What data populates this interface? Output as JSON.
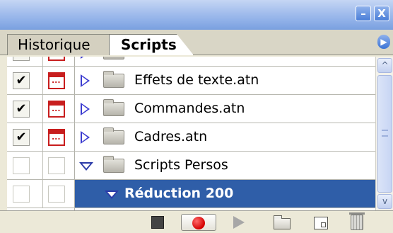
{
  "titlebar": {
    "minimize_glyph": "–",
    "close_glyph": "X"
  },
  "tabs": [
    {
      "label": "Historique",
      "active": false
    },
    {
      "label": "Scripts",
      "active": true
    }
  ],
  "tab_menu_icon": "flyout-menu-icon",
  "rows": [
    {
      "label": "Effets de texte.atn",
      "checked": true,
      "dialog": true,
      "expanded": false,
      "selected": false,
      "icon": "folder-icon"
    },
    {
      "label": "Commandes.atn",
      "checked": true,
      "dialog": true,
      "expanded": false,
      "selected": false,
      "icon": "folder-icon"
    },
    {
      "label": "Cadres.atn",
      "checked": true,
      "dialog": true,
      "expanded": false,
      "selected": false,
      "icon": "folder-icon"
    },
    {
      "label": "Scripts Persos",
      "checked": false,
      "dialog": false,
      "expanded": true,
      "selected": false,
      "icon": "folder-icon"
    },
    {
      "label": "Réduction 200",
      "checked": false,
      "dialog": false,
      "expanded": true,
      "selected": true,
      "icon": "none"
    }
  ],
  "check_glyph": "✔",
  "scrollbar": {
    "up_glyph": "^",
    "down_glyph": "v"
  },
  "toolbar": [
    {
      "name": "stop-icon"
    },
    {
      "name": "record-icon"
    },
    {
      "name": "play-icon"
    },
    {
      "name": "new-set-icon"
    },
    {
      "name": "new-action-icon"
    },
    {
      "name": "trash-icon"
    }
  ],
  "colors": {
    "selection": "#2f5ea8",
    "title_gradient_bottom": "#7aa0df",
    "dialog_red": "#c81e1e",
    "triangle_blue": "#3b3bd0"
  }
}
